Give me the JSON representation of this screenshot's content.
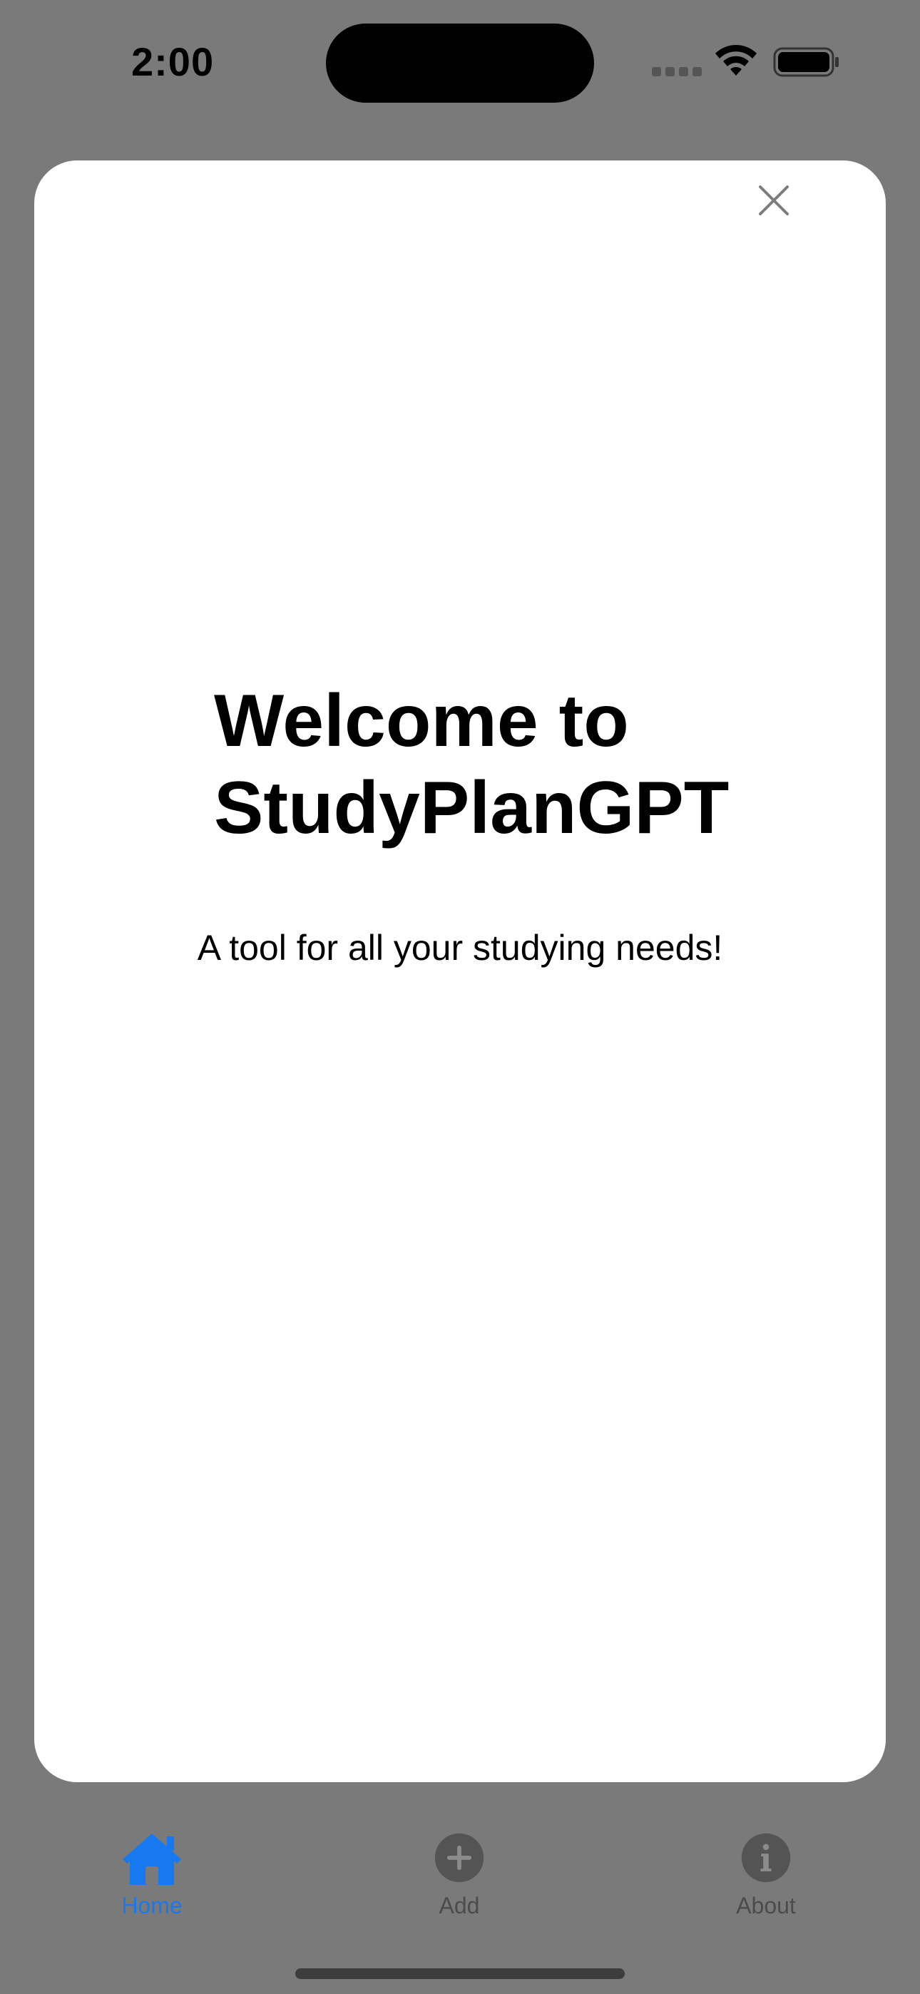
{
  "status_bar": {
    "time": "2:00"
  },
  "sheet": {
    "title_line1": "Welcome to",
    "title_line2": "StudyPlanGPT",
    "subtitle": "A tool for all your studying needs!",
    "close_icon": "close-icon"
  },
  "tab_bar": {
    "tabs": [
      {
        "label": "Home",
        "icon": "house-icon",
        "selected": true
      },
      {
        "label": "Add",
        "icon": "plus-circle-icon",
        "selected": false
      },
      {
        "label": "About",
        "icon": "info-circle-icon",
        "selected": false
      }
    ]
  },
  "colors": {
    "accent": "#1679f0",
    "dimmed_background": "#7a7a7a",
    "sheet": "#ffffff"
  }
}
